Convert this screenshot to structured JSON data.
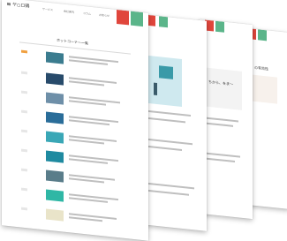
{
  "brand": {
    "logo_text": "ヤ○ロ鶏",
    "accent_red": "#e0463c",
    "accent_green": "#5bb58a",
    "accent_orange": "#f0a040"
  },
  "front_page": {
    "nav_items": [
      "サービス",
      "会社案内",
      "コラム",
      "お知らせ"
    ],
    "section_title": "ホットコーナー一覧",
    "articles": [
      {
        "tag": "NEW",
        "date": "2020.12",
        "title": "リニューアル"
      },
      {
        "tag": "",
        "date": "",
        "title": ""
      },
      {
        "tag": "",
        "date": "",
        "title": ""
      },
      {
        "tag": "",
        "date": "",
        "title": ""
      },
      {
        "tag": "",
        "date": "",
        "title": ""
      },
      {
        "tag": "",
        "date": "",
        "title": ""
      },
      {
        "tag": "",
        "date": "",
        "title": ""
      },
      {
        "tag": "",
        "date": "",
        "title": ""
      },
      {
        "tag": "",
        "date": "",
        "title": ""
      }
    ]
  },
  "third_page": {
    "headline": "ちから、をま〜"
  },
  "fourth_page": {
    "headline": "の有効性"
  },
  "icons": [
    "menu-icon",
    "person-icon",
    "monitor-icon"
  ]
}
